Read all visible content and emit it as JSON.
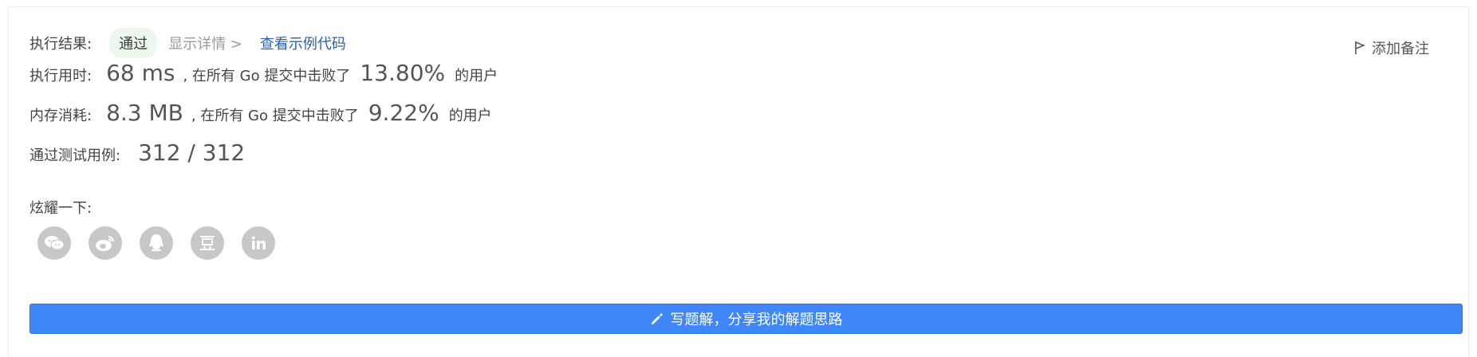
{
  "result": {
    "label": "执行结果:",
    "status": "通过",
    "details_link": "显示详情 >",
    "sample_code_link": "查看示例代码"
  },
  "add_note": "添加备注",
  "runtime": {
    "label": "执行用时:",
    "value": "68 ms",
    "text_mid": ", 在所有 Go 提交中击败了",
    "percent": "13.80%",
    "text_end": "的用户"
  },
  "memory": {
    "label": "内存消耗:",
    "value": "8.3 MB",
    "text_mid": ", 在所有 Go 提交中击败了",
    "percent": "9.22%",
    "text_end": "的用户"
  },
  "tests": {
    "label": "通过测试用例:",
    "value": "312 / 312"
  },
  "share": {
    "label": "炫耀一下:",
    "icons": [
      "wechat-icon",
      "weibo-icon",
      "qq-icon",
      "douban-icon",
      "linkedin-icon"
    ]
  },
  "write_solution": "写题解，分享我的解题思路"
}
